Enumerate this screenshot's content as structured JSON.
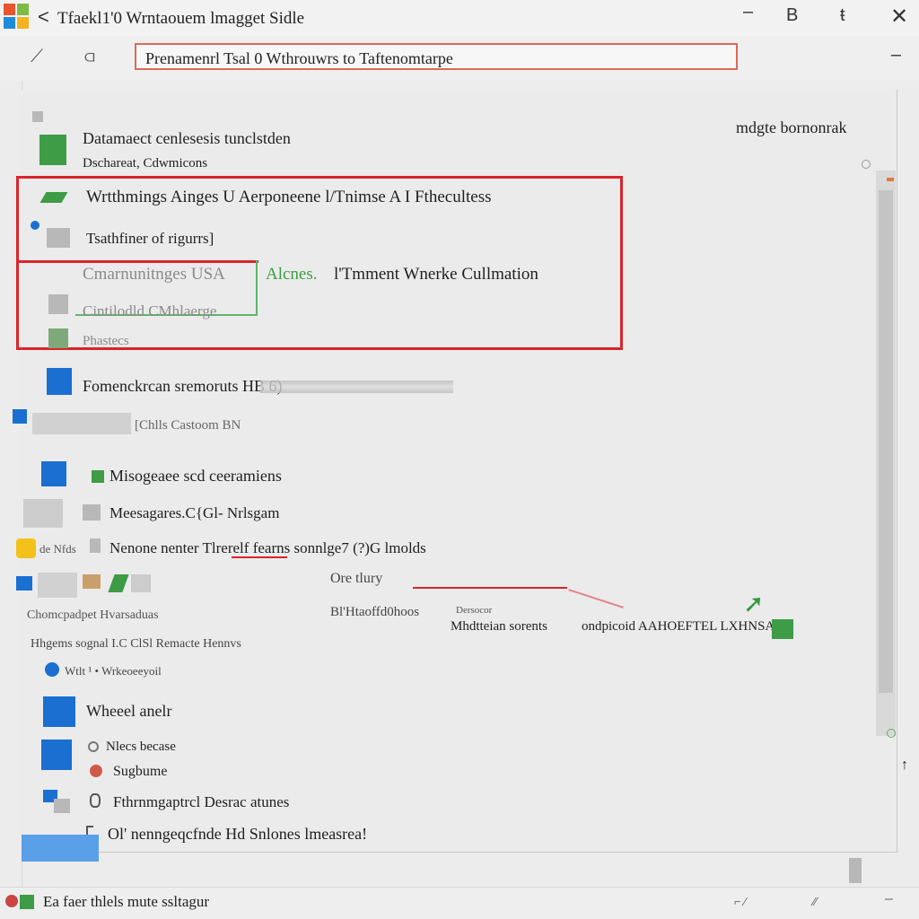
{
  "titlebar": {
    "back_glyph": "<",
    "title": "Tfaekl1'0  Wrntaouem lmagget Sidle",
    "controls": [
      "B",
      "ŧ",
      "✕"
    ]
  },
  "address": {
    "value": "Prenamenrl Tsal 0 Wthrouwrs to Taftenomtarpe"
  },
  "header": {
    "right_label": "mdgte bornonrak"
  },
  "list": {
    "row1_title": "Datamaect cenlesesis tunclstden",
    "row1_sub": "Dschareat, Cdwmicons",
    "hl1_title": "Wrtthmings Ainges U Aerponeene l/Tnimse A I Fthecultess",
    "hl1_sub": "Tsathfiner of rigurrs]",
    "hl2_grey": "Cmarnunitnges USA",
    "hl2_green": "Alcnes.",
    "hl2_rest": "l'Tmment Wnerke  Cullmation",
    "hl2_sub": "Cintilodld CMhlaerge",
    "hl2_sub2": "Phastecs",
    "row2": "Fomenckrcan sremoruts HB 6)",
    "row3": "[Chlls Castoom  BN",
    "row4": "Misogeaee scd ceeramiens",
    "row5": "Meesagares.C{Gl- Nrlsgam",
    "row6": "Nenone nenter  Tlrerelf fearns sonnlge7 (?)G lmolds",
    "row6_left": "de Nfds",
    "row7_mid": "Ore tlury",
    "row8_left": "Chomcpadpet Hvarsaduas",
    "row8_mid": "Bl'Htaoffd0hoos",
    "row8_right_small": "Dersocor",
    "row8_right": "Mhdtteian sorents",
    "row8_far": "ondpicoid AAHOEFTEL LXHNSA L",
    "row9": "Hhgems  sognal I.C ClSl Remacte Hennvs",
    "row10": "Wtlt ¹ • Wrkeoeeyoil",
    "row11": "Wheeel anelr",
    "row12": "Nlecs becase",
    "row13": "Sugbume",
    "row14": "Fthrnmgaptrcl Desrac atunes",
    "row15": "Ol' nenngeqcfnde   Hd Snlones lmeasrea!"
  },
  "statusbar": {
    "left": "Ea faer thlels mute ssltagur"
  },
  "colors": {
    "highlight": "#d8252a",
    "accent_green": "#3d9c45",
    "accent_blue": "#1a6fd1"
  }
}
